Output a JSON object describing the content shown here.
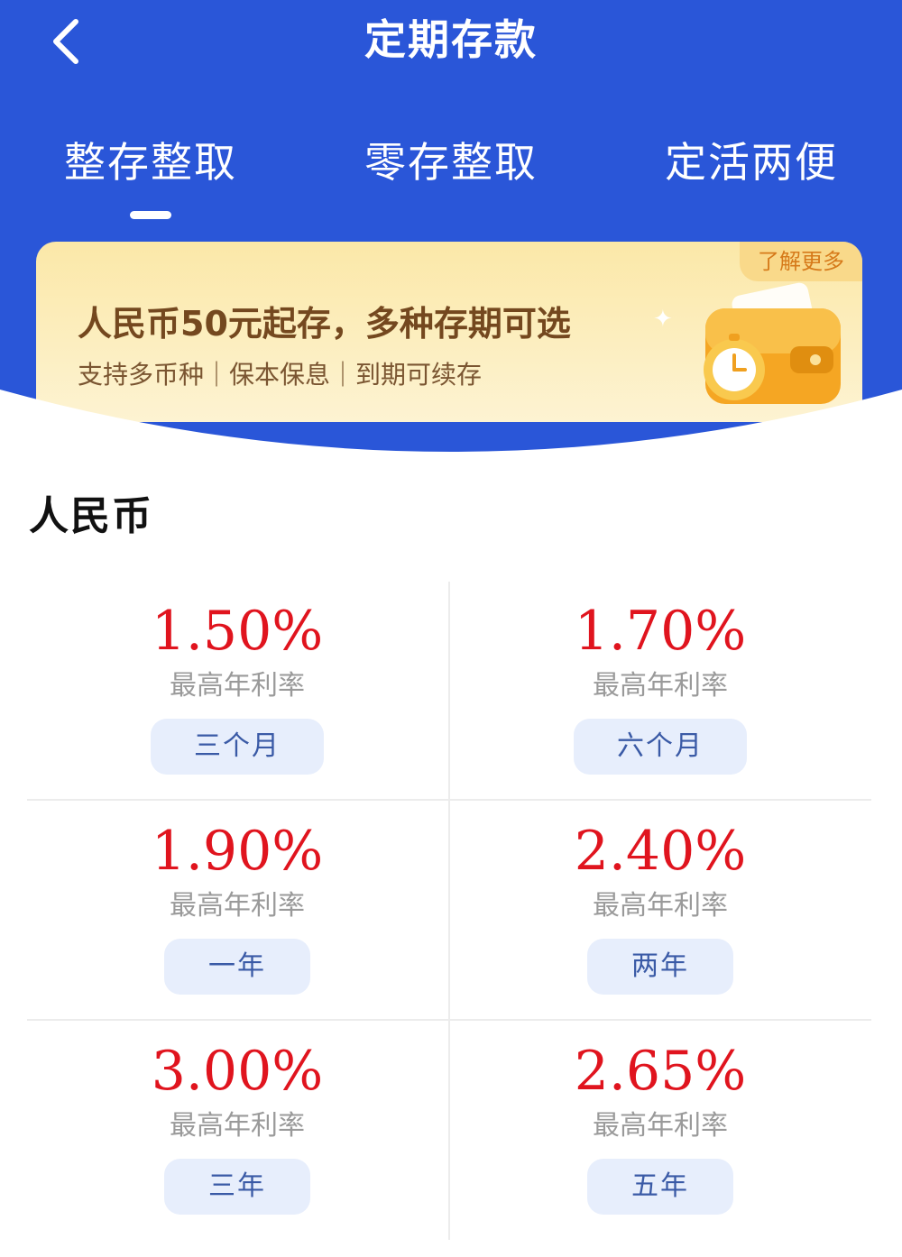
{
  "header": {
    "title": "定期存款",
    "back_icon": "chevron-left-icon"
  },
  "tabs": [
    {
      "label": "整存整取",
      "active": true
    },
    {
      "label": "零存整取",
      "active": false
    },
    {
      "label": "定活两便",
      "active": false
    }
  ],
  "banner": {
    "title": "人民币50元起存，多种存期可选",
    "subtitle": "支持多币种｜保本保息｜到期可续存",
    "learn_more": "了解更多",
    "illustration": "wallet-clock-icon"
  },
  "section": {
    "title": "人民币"
  },
  "rates": [
    {
      "rate": "1.50%",
      "label": "最高年利率",
      "term": "三个月"
    },
    {
      "rate": "1.70%",
      "label": "最高年利率",
      "term": "六个月"
    },
    {
      "rate": "1.90%",
      "label": "最高年利率",
      "term": "一年"
    },
    {
      "rate": "2.40%",
      "label": "最高年利率",
      "term": "两年"
    },
    {
      "rate": "3.00%",
      "label": "最高年利率",
      "term": "三年"
    },
    {
      "rate": "2.65%",
      "label": "最高年利率",
      "term": "五年"
    }
  ],
  "colors": {
    "header_blue": "#2a56d8",
    "rate_red": "#e0141e",
    "pill_bg": "#e7eefc",
    "banner_text": "#74481f"
  }
}
